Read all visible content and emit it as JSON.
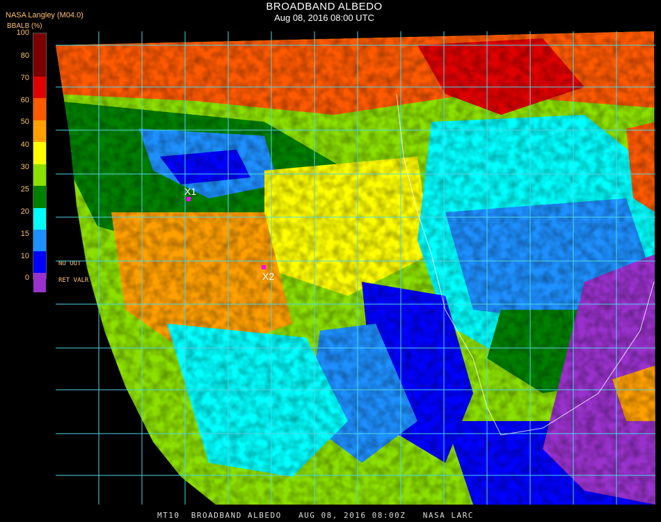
{
  "header": {
    "title": "BROADBAND ALBEDO",
    "subtitle": "Aug 08, 2016 08:00 UTC",
    "credit": "NASA Langley (M04.0)"
  },
  "legend": {
    "title": "BBALB (%)",
    "ticks": [
      "100",
      "80",
      "70",
      "60",
      "50",
      "40",
      "30",
      "25",
      "20",
      "15",
      "10",
      "0"
    ],
    "bins": [
      {
        "range": "80-100",
        "color": "#7a0000"
      },
      {
        "range": "70-80",
        "color": "#e00000"
      },
      {
        "range": "60-70",
        "color": "#ff5a00"
      },
      {
        "range": "50-60",
        "color": "#ffa000"
      },
      {
        "range": "40-50",
        "color": "#ffff00"
      },
      {
        "range": "30-40",
        "color": "#8ce000"
      },
      {
        "range": "25-30",
        "color": "#008000"
      },
      {
        "range": "20-25",
        "color": "#00ffff"
      },
      {
        "range": "15-20",
        "color": "#1e90ff"
      },
      {
        "range": "10-15",
        "color": "#0000ff"
      },
      {
        "range": "0-10",
        "color": "#9932cc"
      }
    ],
    "no_value_1": "NO    OUT",
    "no_value_2": "RET   VALR"
  },
  "markers": [
    {
      "label": "X1"
    },
    {
      "label": "X2"
    }
  ],
  "footer": "MT10  BROADBAND ALBEDO   AUG 08, 2016 08:00Z   NASA LARC"
}
